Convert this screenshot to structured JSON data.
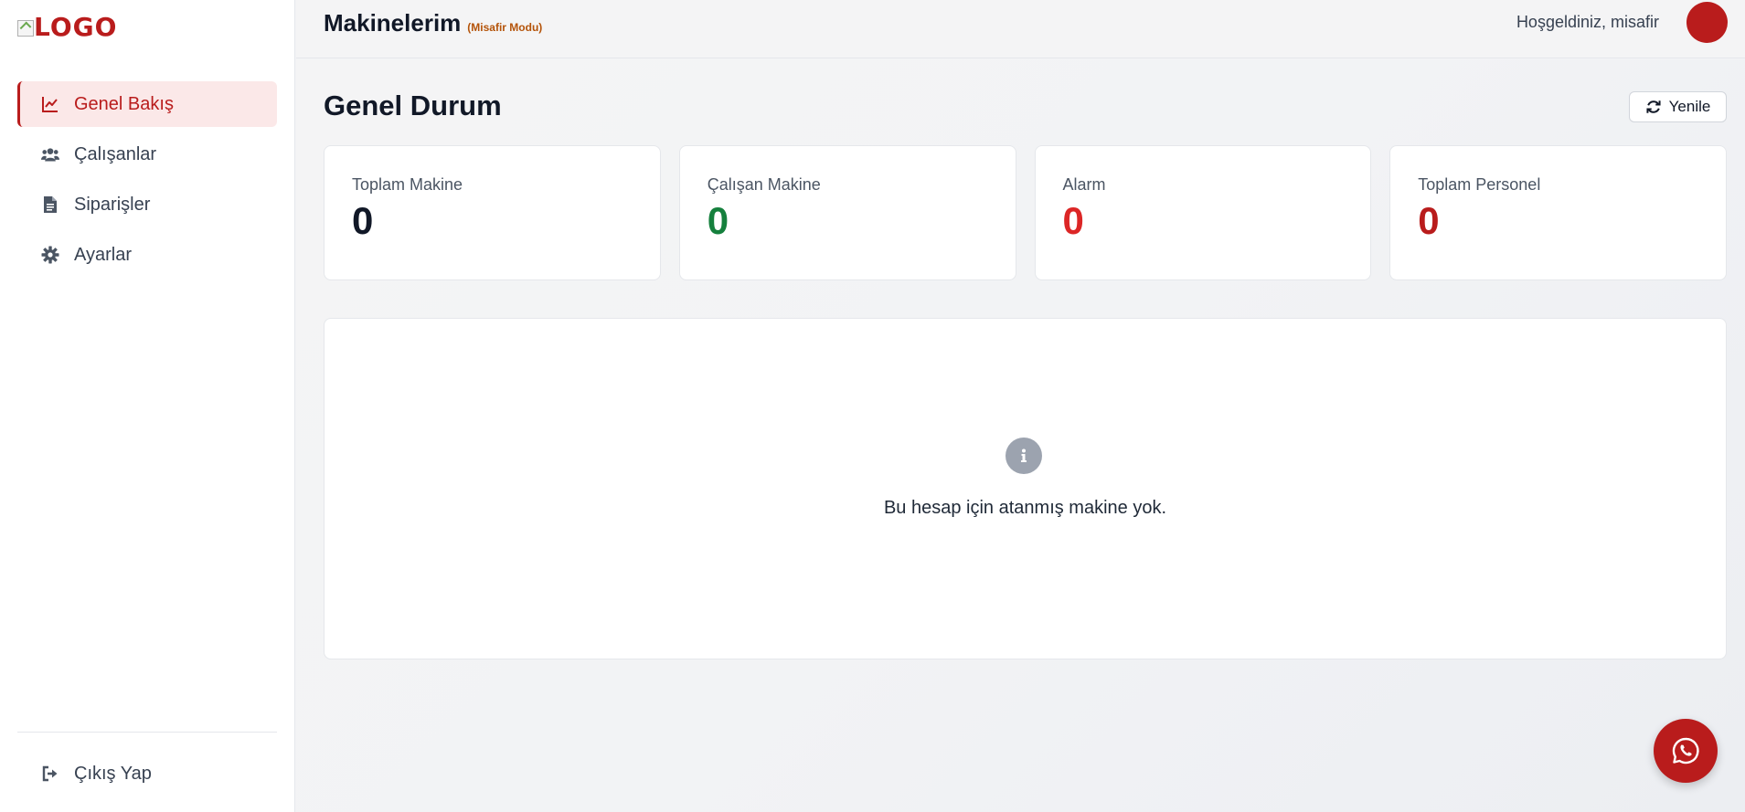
{
  "sidebar": {
    "logo_text": "LOGO",
    "items": [
      {
        "label": "Genel Bakış",
        "icon": "chart-line-icon",
        "active": true
      },
      {
        "label": "Çalışanlar",
        "icon": "users-icon",
        "active": false
      },
      {
        "label": "Siparişler",
        "icon": "file-icon",
        "active": false
      },
      {
        "label": "Ayarlar",
        "icon": "gear-icon",
        "active": false
      }
    ],
    "logout_label": "Çıkış Yap"
  },
  "header": {
    "title": "Makinelerim",
    "mode": "(Misafir Modu)",
    "welcome": "Hoşgeldiniz, misafir"
  },
  "main": {
    "page_title": "Genel Durum",
    "refresh_label": "Yenile",
    "cards": [
      {
        "label": "Toplam Makine",
        "value": "0",
        "color": "#111827"
      },
      {
        "label": "Çalışan Makine",
        "value": "0",
        "color": "#15803d"
      },
      {
        "label": "Alarm",
        "value": "0",
        "color": "#dc2626"
      },
      {
        "label": "Toplam Personel",
        "value": "0",
        "color": "#b91c1c"
      }
    ],
    "empty_message": "Bu hesap için atanmış makine yok."
  },
  "colors": {
    "accent": "#b91c1c",
    "active_bg": "#fbe8e8"
  }
}
